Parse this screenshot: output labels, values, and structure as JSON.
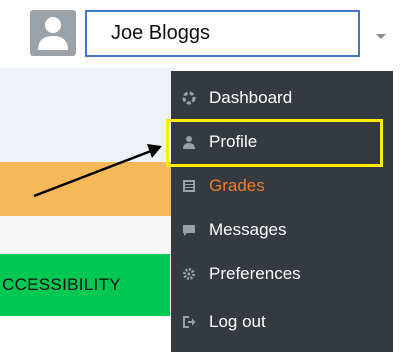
{
  "user": {
    "name": "Joe Bloggs"
  },
  "menu": {
    "items": [
      {
        "label": "Dashboard",
        "icon": "dashboard-icon"
      },
      {
        "label": "Profile",
        "icon": "user-icon"
      },
      {
        "label": "Grades",
        "icon": "grades-icon",
        "active": true
      },
      {
        "label": "Messages",
        "icon": "message-icon"
      },
      {
        "label": "Preferences",
        "icon": "gear-icon"
      },
      {
        "label": "Log out",
        "icon": "logout-icon"
      }
    ]
  },
  "page": {
    "accessibility_label": "CCESSIBILITY"
  },
  "colors": {
    "menu_bg": "#343a40",
    "active_item": "#f07b2b",
    "highlight": "#ffee00",
    "user_box_border": "#4472c4",
    "accessibility_bg": "#00c853",
    "banner": "#f5b95a"
  }
}
